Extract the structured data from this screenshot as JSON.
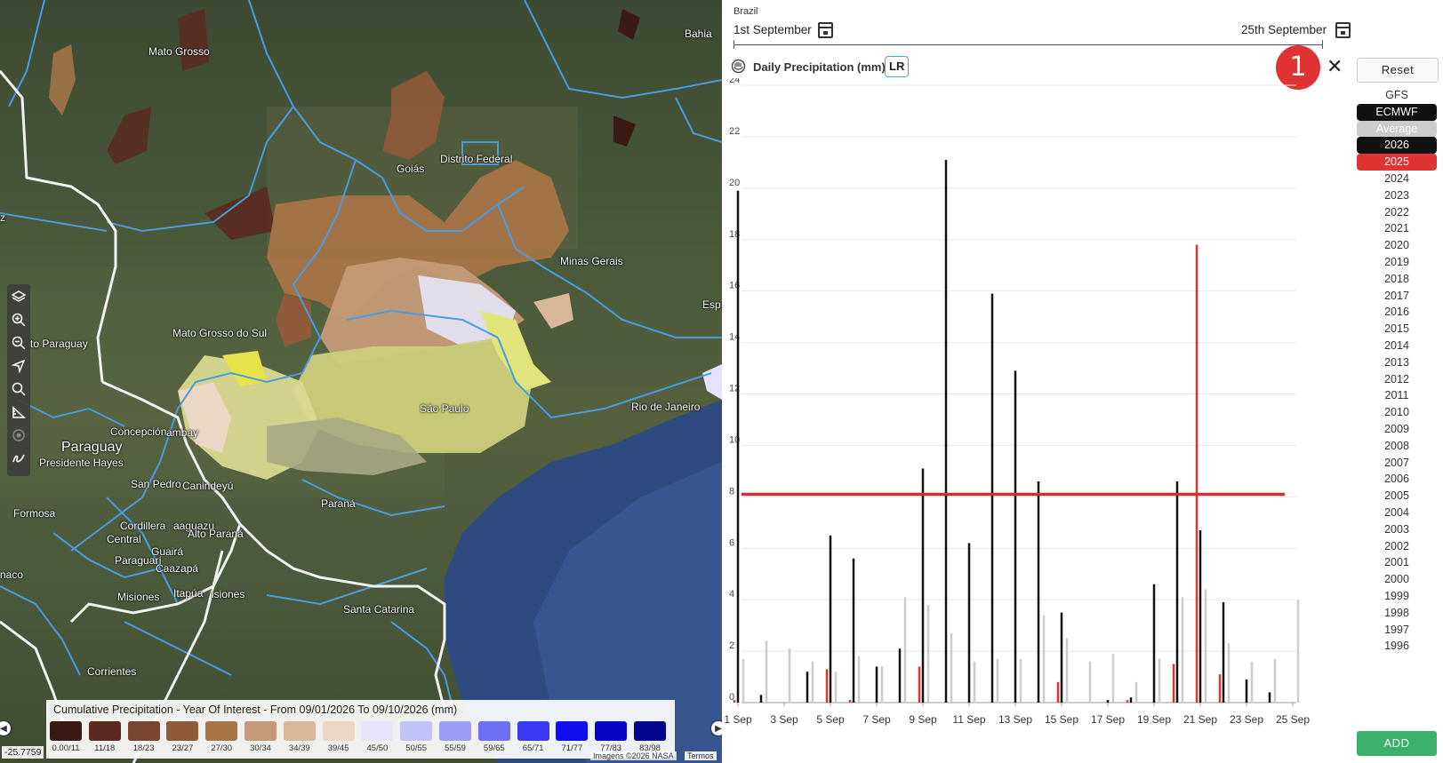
{
  "map": {
    "labels": {
      "mato_grosso": "Mato Grosso",
      "bahia": "Bahia",
      "goias": "Goiás",
      "distrito_federal": "Distrito Federal",
      "minas_gerais": "Minas Gerais",
      "mato_grosso_do_sul": "Mato Grosso do Sul",
      "paraguay": "Paraguay",
      "presidente_hayes": "Presidente Hayes",
      "concepcion": "Concepción",
      "amambay": "ambay",
      "to_paraguay": "to Paraguay",
      "sao_paulo": "São Paulo",
      "rio_de_janeiro": "Rio de Janeiro",
      "esp": "Esp",
      "san_pedro": "San Pedro",
      "canindeyu": "Canindeyú",
      "parana": "Paraná",
      "formosa": "Formosa",
      "cordillera": "Cordillera",
      "caaguazu": "aaguazu",
      "central": "Central",
      "alto_parana": "Alto Paraná",
      "paraguari": "Paraguarí",
      "guaira": "Guairá",
      "caazapa": "Caazapá",
      "misiones": "Misiones",
      "itapua": "Itapúa",
      "misiones2": "isiones",
      "santa_catarina": "Santa Catarina",
      "chaco": "naco",
      "corrientes": "Corrientes",
      "z": "z"
    },
    "legend": {
      "title": "Cumulative Precipitation - Year Of Interest - From 09/01/2026 To 09/10/2026 (mm)",
      "items": [
        {
          "label": "0.00/11",
          "color": "#3a1a14"
        },
        {
          "label": "11/18",
          "color": "#5a2a20"
        },
        {
          "label": "18/23",
          "color": "#7a4530"
        },
        {
          "label": "23/27",
          "color": "#8f5a38"
        },
        {
          "label": "27/30",
          "color": "#a87548"
        },
        {
          "label": "30/34",
          "color": "#c49a78"
        },
        {
          "label": "34/39",
          "color": "#d8b898"
        },
        {
          "label": "39/45",
          "color": "#ead8c4"
        },
        {
          "label": "45/50",
          "color": "#e6e4f8"
        },
        {
          "label": "50/55",
          "color": "#c2c2f8"
        },
        {
          "label": "55/59",
          "color": "#9c9cf4"
        },
        {
          "label": "59/65",
          "color": "#6f6ff4"
        },
        {
          "label": "65/71",
          "color": "#3a3af0"
        },
        {
          "label": "71/77",
          "color": "#1010ec"
        },
        {
          "label": "77/83",
          "color": "#0606c4"
        },
        {
          "label": "83/98",
          "color": "#04048e"
        }
      ]
    },
    "coordinate": "-25.7759",
    "attribution": "Imagens ©2026 NASA",
    "terms": "Termos"
  },
  "panel": {
    "country": "Brazil",
    "date_start": "1st September",
    "date_end": "25th September",
    "chart_title": "Daily Precipitation (mm)",
    "lr_label": "LR",
    "badge": "1",
    "close": "✕",
    "reset": "Reset",
    "model_gfs": "GFS",
    "model_ecmwf": "ECMWF",
    "average": "Average",
    "years": [
      "2026",
      "2025",
      "2024",
      "2023",
      "2022",
      "2021",
      "2020",
      "2019",
      "2018",
      "2017",
      "2016",
      "2015",
      "2014",
      "2013",
      "2012",
      "2011",
      "2010",
      "2009",
      "2008",
      "2007",
      "2006",
      "2005",
      "2004",
      "2003",
      "2002",
      "2001",
      "2000",
      "1999",
      "1998",
      "1997",
      "1996"
    ],
    "add": "ADD"
  },
  "colors": {
    "year_2026": "#111111",
    "year_2025": "#e03333",
    "average": "#cccccc",
    "add_button": "#3bb06a",
    "badge": "#e03333",
    "lr_border": "#4aa3df"
  },
  "chart_data": {
    "type": "bar",
    "ylim": [
      0,
      24
    ],
    "yticks": [
      0,
      2,
      4,
      6,
      8,
      10,
      12,
      14,
      16,
      18,
      20,
      22,
      24
    ],
    "xtick_labels": [
      "1 Sep",
      "3 Sep",
      "5 Sep",
      "7 Sep",
      "9 Sep",
      "11 Sep",
      "13 Sep",
      "15 Sep",
      "17 Sep",
      "19 Sep",
      "21 Sep",
      "23 Sep",
      "25 Sep"
    ],
    "days": [
      1,
      2,
      3,
      4,
      5,
      6,
      7,
      8,
      9,
      10,
      11,
      12,
      13,
      14,
      15,
      16,
      17,
      18,
      19,
      20,
      21,
      22,
      23,
      24,
      25
    ],
    "series": [
      {
        "name": "2026",
        "color": "#111111",
        "values": [
          19.9,
          0.3,
          0,
          1.2,
          6.5,
          5.6,
          1.4,
          2.1,
          9.1,
          21.1,
          6.2,
          15.9,
          12.9,
          8.6,
          3.5,
          0,
          0.1,
          0.2,
          4.6,
          8.6,
          6.7,
          3.9,
          0.9,
          0.4,
          0
        ]
      },
      {
        "name": "2025",
        "color": "#e03333",
        "values": [
          0.1,
          0,
          0,
          0,
          1.3,
          0.1,
          0,
          0,
          1.4,
          0,
          0,
          0,
          0,
          0,
          0.8,
          0,
          0,
          0.1,
          0,
          1.5,
          17.8,
          1.1,
          0,
          0,
          0
        ]
      },
      {
        "name": "Average",
        "color": "#cccccc",
        "values": [
          1.7,
          2.4,
          2.1,
          1.6,
          1.2,
          1.8,
          1.4,
          4.1,
          3.8,
          2.7,
          1.6,
          1.7,
          1.7,
          3.4,
          2.5,
          1.6,
          1.9,
          0.8,
          1.7,
          4.1,
          4.4,
          2.3,
          1.6,
          1.7,
          4.0
        ]
      }
    ],
    "reference_line": {
      "value": 8.1,
      "color": "#d03030"
    }
  }
}
